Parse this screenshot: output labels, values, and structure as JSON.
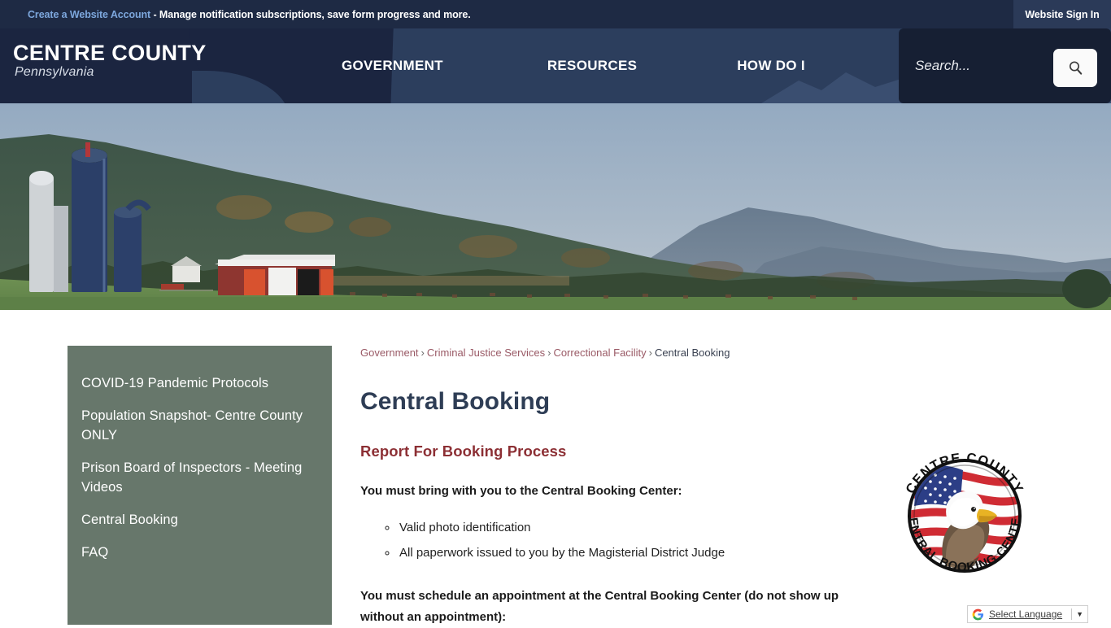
{
  "utility": {
    "account_link": "Create a Website Account",
    "message": " - Manage notification subscriptions, save form progress and more.",
    "signin_label": "Website Sign In"
  },
  "header": {
    "logo_title": "CENTRE COUNTY",
    "logo_subtitle": "Pennsylvania",
    "nav": [
      {
        "label": "GOVERNMENT"
      },
      {
        "label": "RESOURCES"
      },
      {
        "label": "HOW DO I"
      }
    ]
  },
  "search": {
    "placeholder": "Search...",
    "value": "",
    "button_icon": "search-icon"
  },
  "hero": {
    "alt": "Rolling hills with fall foliage above a farm with blue silos and a red barn"
  },
  "sidebar": {
    "items": [
      {
        "label": "COVID-19 Pandemic Protocols"
      },
      {
        "label": "Population Snapshot- Centre County ONLY"
      },
      {
        "label": "Prison Board of Inspectors - Meeting Videos"
      },
      {
        "label": "Central Booking"
      },
      {
        "label": "FAQ"
      }
    ]
  },
  "breadcrumb": {
    "items": [
      {
        "label": "Government",
        "link": true
      },
      {
        "label": "Criminal Justice Services",
        "link": true
      },
      {
        "label": "Correctional Facility",
        "link": true
      },
      {
        "label": "Central Booking",
        "link": false
      }
    ],
    "separator": "›"
  },
  "main": {
    "page_title": "Central Booking",
    "section_heading": "Report For Booking Process",
    "intro_bold": "You must bring with you to the Central Booking Center:",
    "bring_list": [
      "Valid photo identification",
      "All paperwork issued to you by the Magisterial District Judge"
    ],
    "appointment_bold": "You must schedule an appointment at the Central Booking Center (do not show up without an appointment):"
  },
  "seal": {
    "top_text": "CENTRE COUNTY",
    "bottom_text": "CENTRAL BOOKING CENTER",
    "alt": "Centre County Central Booking Center seal with bald eagle and American flag"
  },
  "translate": {
    "label": "Select Language",
    "caret": "▼",
    "google_g": "G"
  },
  "colors": {
    "utility_bg": "#1e2a44",
    "header_bg": "#2c3e5d",
    "header_dark": "#1b2540",
    "search_panel": "#161f33",
    "sidebar_bg": "#67776b",
    "title_navy": "#2e3d55",
    "heading_maroon": "#8c2f34",
    "breadcrumb_link": "#9a5a66",
    "account_link": "#7da7dd"
  }
}
